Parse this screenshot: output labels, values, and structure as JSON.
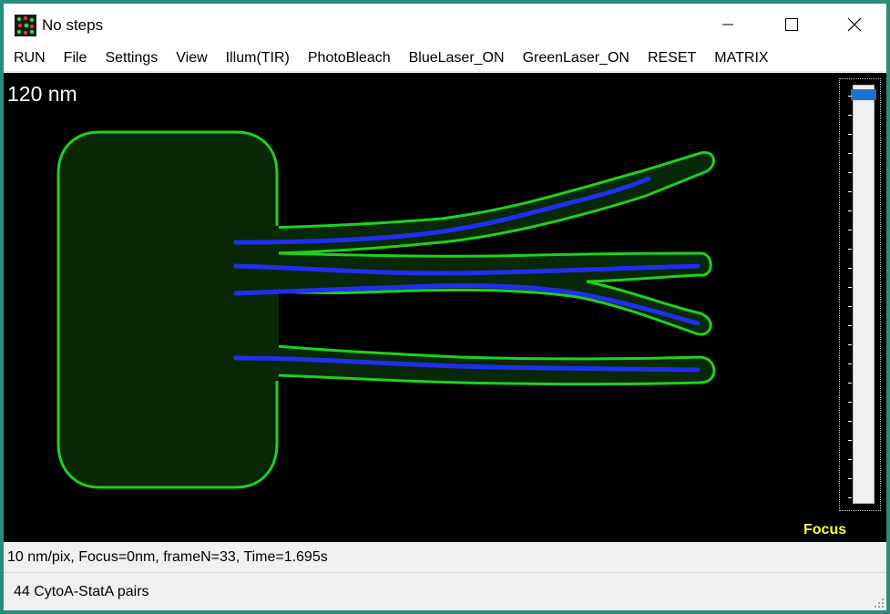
{
  "window": {
    "title": "No steps"
  },
  "menu": {
    "items": [
      "RUN",
      "File",
      "Settings",
      "View",
      "Illum(TIR)",
      "PhotoBleach",
      "BlueLaser_ON",
      "GreenLaser_ON",
      "RESET",
      "MATRIX"
    ]
  },
  "canvas": {
    "scale_label": "120 nm",
    "focus_label": "Focus",
    "focus_slider_value": 0,
    "colors": {
      "background": "#000000",
      "cell_outline": "#1fd11f",
      "cell_fill": "#082808",
      "filament": "#1f2ff0",
      "focus_label": "#ffff33",
      "slider_thumb": "#1a73d0"
    }
  },
  "status": {
    "line1": "10 nm/pix, Focus=0nm, frameN=33, Time=1.695s",
    "line2": "44 CytoA-StatA pairs"
  },
  "icons": {
    "app": "app-icon",
    "minimize": "minimize-icon",
    "maximize": "maximize-icon",
    "close": "close-icon",
    "resize_grip": "resize-grip-icon"
  }
}
